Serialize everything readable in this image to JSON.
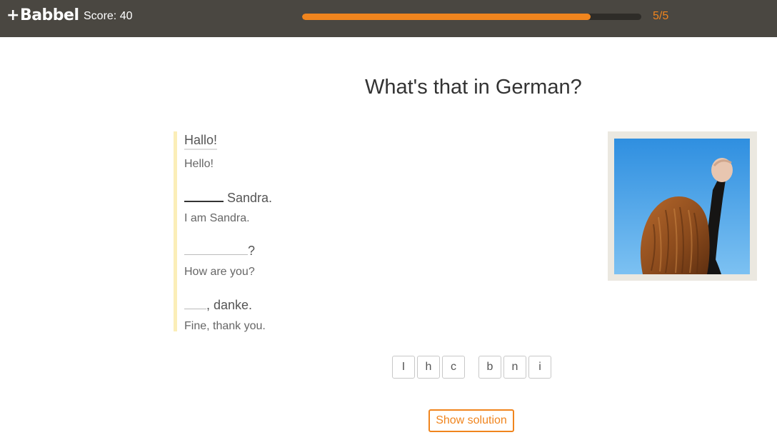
{
  "header": {
    "logo_text": "Babbel",
    "score_text": "Score: 40",
    "progress_fraction": 0.85,
    "progress_count": "5/5",
    "accent_color": "#f0851e",
    "bar_color": "#4a4741"
  },
  "exercise": {
    "title": "What's that in German?",
    "dialogue": [
      {
        "de_word": "Hallo!",
        "en": "Hello!"
      },
      {
        "de_suffix": "Sandra.",
        "en": "I am Sandra."
      },
      {
        "de_suffix": "?",
        "en": "How are you?"
      },
      {
        "de_suffix": ", danke.",
        "en": "Fine, thank you."
      }
    ],
    "image_icon": "woman-raising-fist-photo",
    "tiles_group1": [
      "I",
      "h",
      "c"
    ],
    "tiles_group2": [
      "b",
      "n",
      "i"
    ],
    "show_solution_label": "Show solution"
  }
}
